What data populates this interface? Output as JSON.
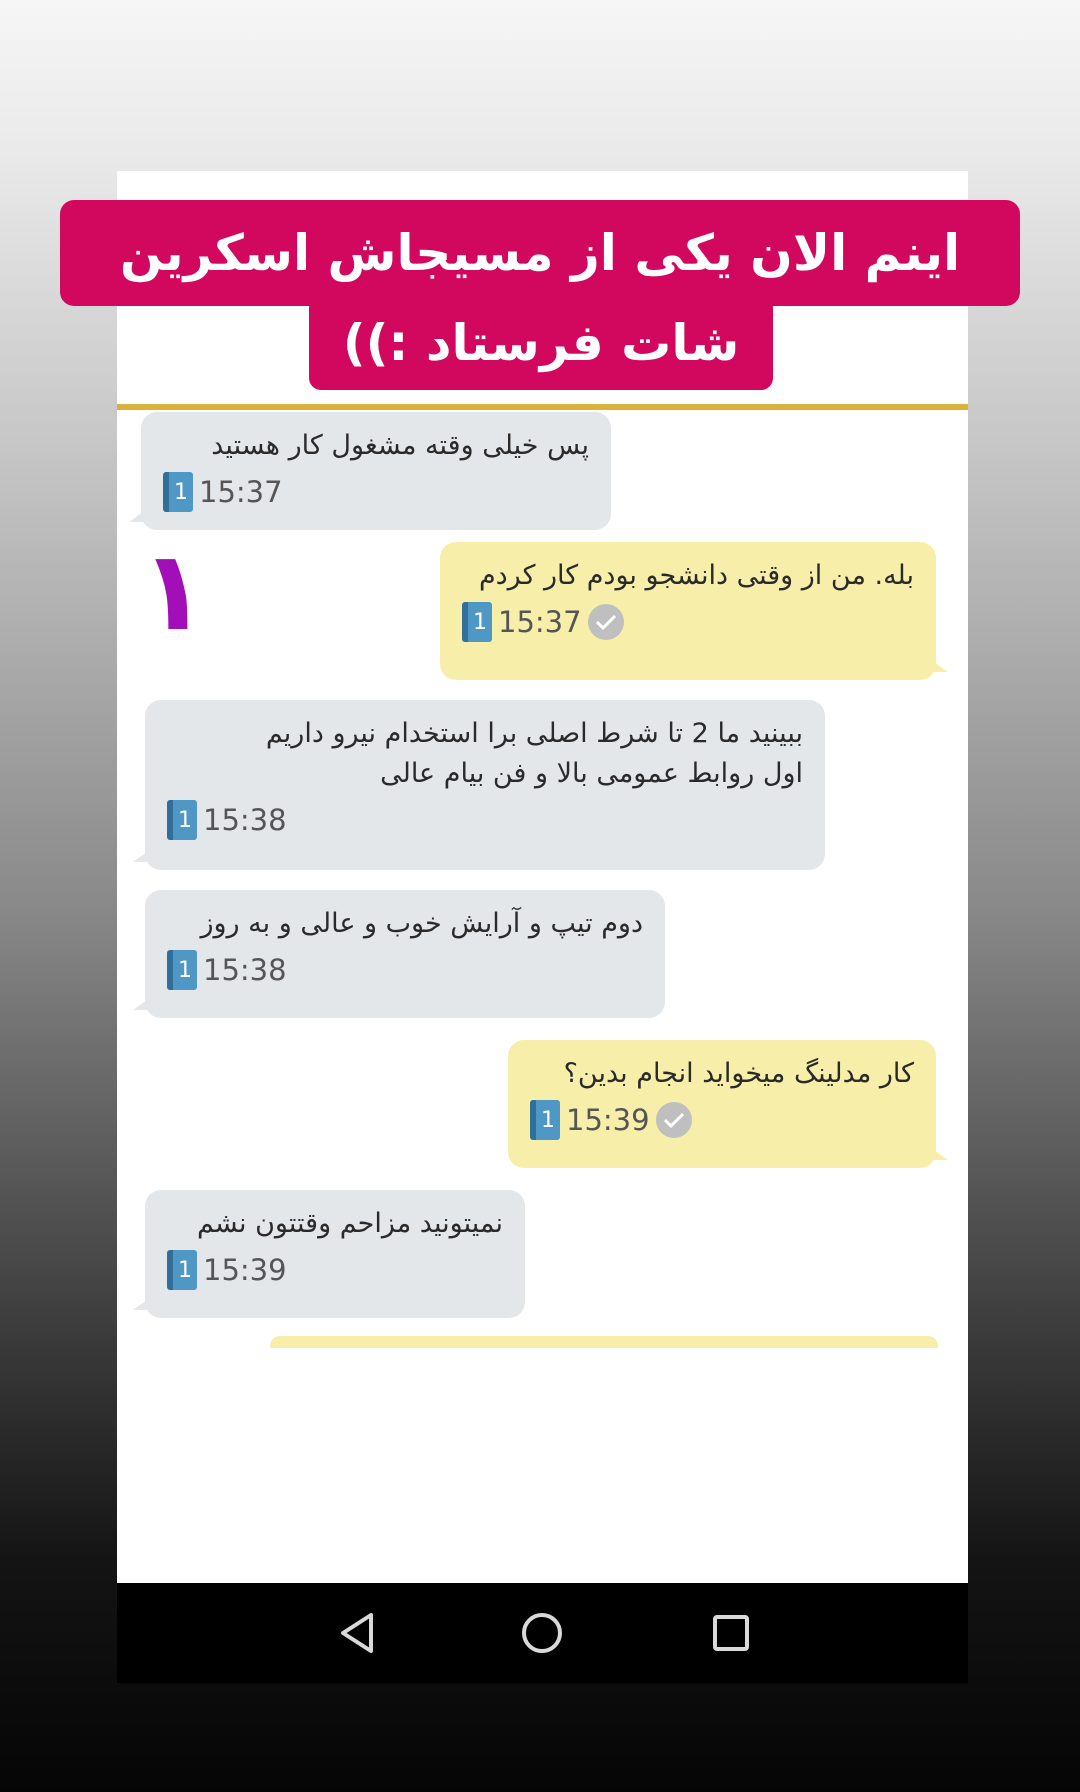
{
  "caption": {
    "line1": "اینم الان یکی از مسیجاش اسکرین",
    "line2": "شات فرستاد :))"
  },
  "marker": "۱",
  "messages": [
    {
      "direction": "in",
      "lines": [
        "پس خیلی وقته مشغول کار هستید"
      ],
      "doc_count": "1",
      "time": "15:37"
    },
    {
      "direction": "out",
      "lines": [
        "بله. من از وقتی دانشجو بودم کار کردم"
      ],
      "doc_count": "1",
      "time": "15:37",
      "status": "read-check"
    },
    {
      "direction": "in",
      "lines": [
        "ببینید ما 2 تا شرط اصلی برا استخدام نیرو داریم",
        "اول روابط عمومی بالا و فن بیام عالی"
      ],
      "doc_count": "1",
      "time": "15:38"
    },
    {
      "direction": "in",
      "lines": [
        "دوم تیپ و آرایش خوب و عالی و به روز"
      ],
      "doc_count": "1",
      "time": "15:38"
    },
    {
      "direction": "out",
      "lines": [
        "کار مدلینگ میخواید انجام بدین؟"
      ],
      "doc_count": "1",
      "time": "15:39",
      "status": "read-check"
    },
    {
      "direction": "in",
      "lines": [
        "نمیتونید مزاحم وقتتون نشم"
      ],
      "doc_count": "1",
      "time": "15:39"
    }
  ],
  "navigation": {
    "back": "back-icon",
    "home": "home-icon",
    "recents": "recents-icon"
  },
  "colors": {
    "caption_bg": "#d1085e",
    "incoming_bubble": "#e4e7ea",
    "outgoing_bubble": "#f7eeaa",
    "header_rule": "#d8b23a",
    "marker": "#a20fb8",
    "doc_icon": "#4f97c4"
  }
}
